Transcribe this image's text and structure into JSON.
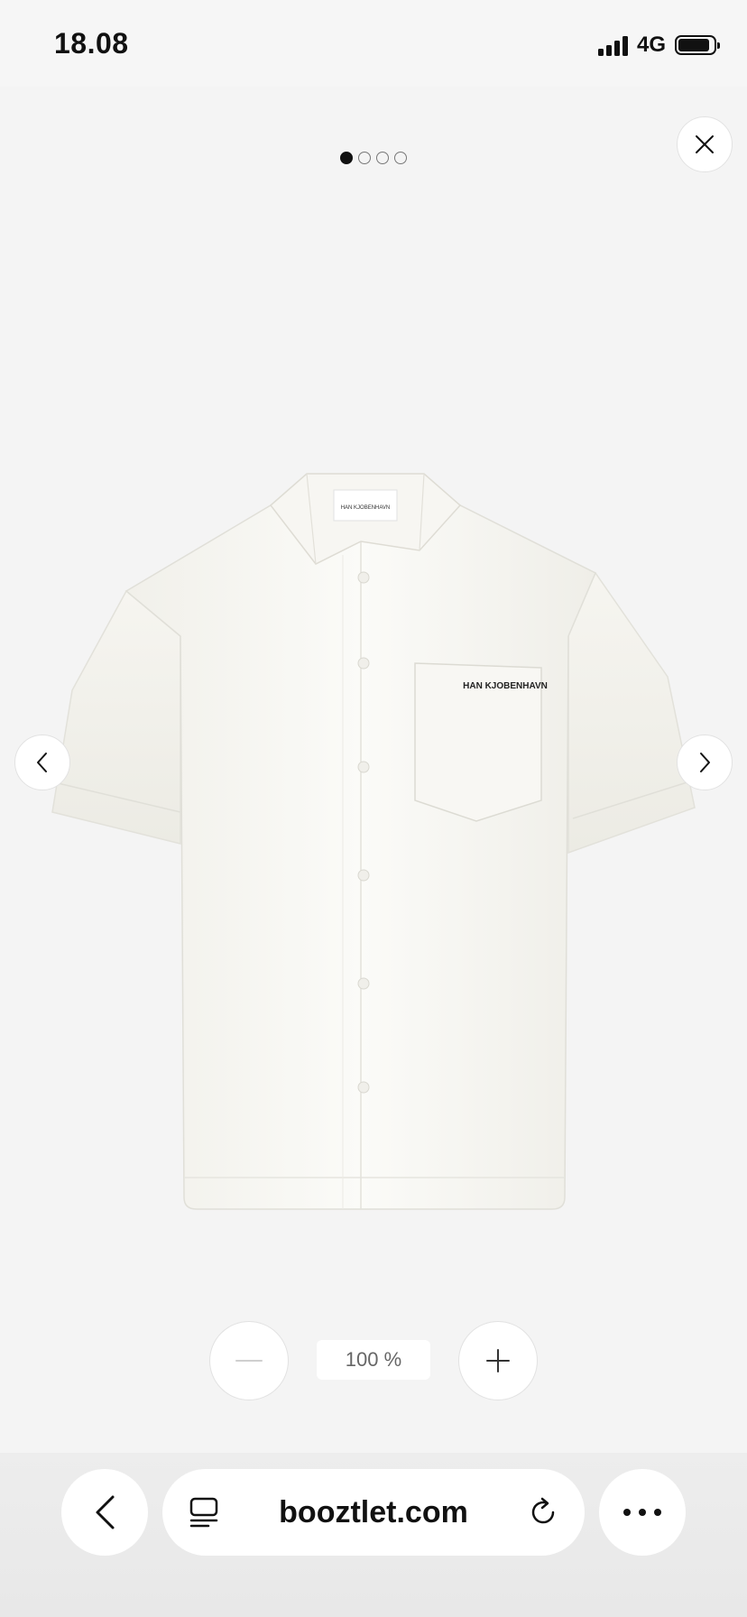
{
  "status_bar": {
    "time": "18.08",
    "network": "4G"
  },
  "gallery": {
    "page_count": 4,
    "current_page": 1,
    "close_icon": "close-icon",
    "prev_icon": "chevron-left-icon",
    "next_icon": "chevron-right-icon",
    "pocket_label": "HAN KJOBENHAVN",
    "collar_label": "HAN KJOBENHAVN"
  },
  "zoom": {
    "level": "100 %",
    "minus_icon": "minus-icon",
    "plus_icon": "plus-icon"
  },
  "browser": {
    "url": "booztlet.com",
    "back_icon": "chevron-left-icon",
    "tab_icon": "tabs-icon",
    "reload_icon": "reload-icon",
    "more_icon": "more-icon"
  }
}
